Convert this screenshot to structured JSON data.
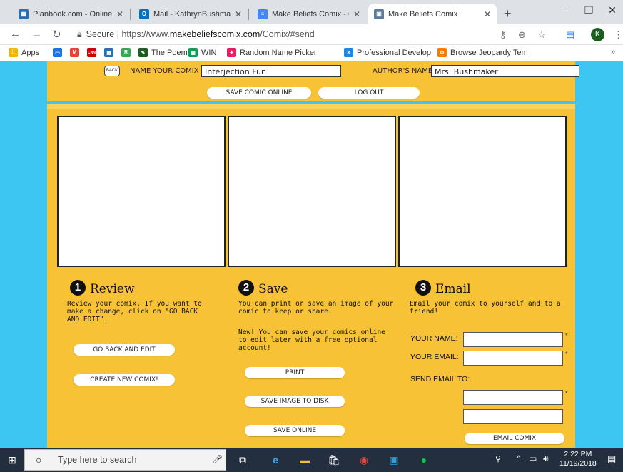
{
  "browser": {
    "tabs": [
      {
        "title": "Planbook.com - Online L",
        "icon_color": "#2a6fb0"
      },
      {
        "title": "Mail - KathrynBushmaker",
        "icon_color": "#0072c6",
        "icon_text": "O"
      },
      {
        "title": "Make Beliefs Comix - Go",
        "icon_color": "#4285f4"
      },
      {
        "title": "Make Beliefs Comix",
        "icon_color": "#5b7c99",
        "active": true
      }
    ],
    "new_tab": "+",
    "url_secure": "Secure",
    "url_prefix": "https://www.",
    "url_domain": "makebeliefscomix.com",
    "url_path": "/Comix/#send",
    "avatar_letter": "K"
  },
  "bookmarks": [
    {
      "label": "Apps",
      "color": "#f4b400"
    },
    {
      "label": "",
      "color": "#1a73e8"
    },
    {
      "label": "",
      "color": "#ea4335",
      "icon_text": "M"
    },
    {
      "label": "",
      "color": "#cc0000",
      "icon_text": "CNN"
    },
    {
      "label": "",
      "color": "#2a6fb0"
    },
    {
      "label": "",
      "color": "#34a853",
      "icon_text": "R"
    },
    {
      "label": "The Poem",
      "color": "#1b5e20"
    },
    {
      "label": "WIN",
      "color": "#0f9d58"
    },
    {
      "label": "Random Name Picker",
      "color": "#e91e63"
    },
    {
      "label": "Professional Develop",
      "color": "#1e88e5"
    },
    {
      "label": "Browse Jeopardy Tem",
      "color": "#f57c00"
    }
  ],
  "comic": {
    "back_label": "BACK",
    "name_label": "NAME YOUR COMIX",
    "name_value": "Interjection Fun",
    "author_label": "AUTHOR'S NAME",
    "author_value": "Mrs. Bushmaker",
    "save_online": "SAVE COMIC ONLINE",
    "log_out": "LOG OUT"
  },
  "review": {
    "num": "1",
    "heading": "Review",
    "text": "Review your comix. If you want to make a change, click on \"GO BACK AND EDIT\".",
    "go_back": "GO BACK AND EDIT",
    "create_new": "CREATE NEW COMIX!"
  },
  "save": {
    "num": "2",
    "heading": "Save",
    "text": "You can print or save an image of your comic to keep or share.",
    "text2": "New! You can save your comics online to edit later with a free optional account!",
    "print": "PRINT",
    "save_image": "SAVE IMAGE TO DISK",
    "save_online": "SAVE ONLINE"
  },
  "email": {
    "num": "3",
    "heading": "Email",
    "text": "Email your comix to yourself and to a friend!",
    "your_name": "YOUR NAME:",
    "your_email": "YOUR EMAIL:",
    "send_to": "SEND EMAIL TO:",
    "send_button": "EMAIL COMIX",
    "required_mark": "*"
  },
  "taskbar": {
    "search_placeholder": "Type here to search",
    "time": "2:22 PM",
    "date": "11/19/2018"
  }
}
